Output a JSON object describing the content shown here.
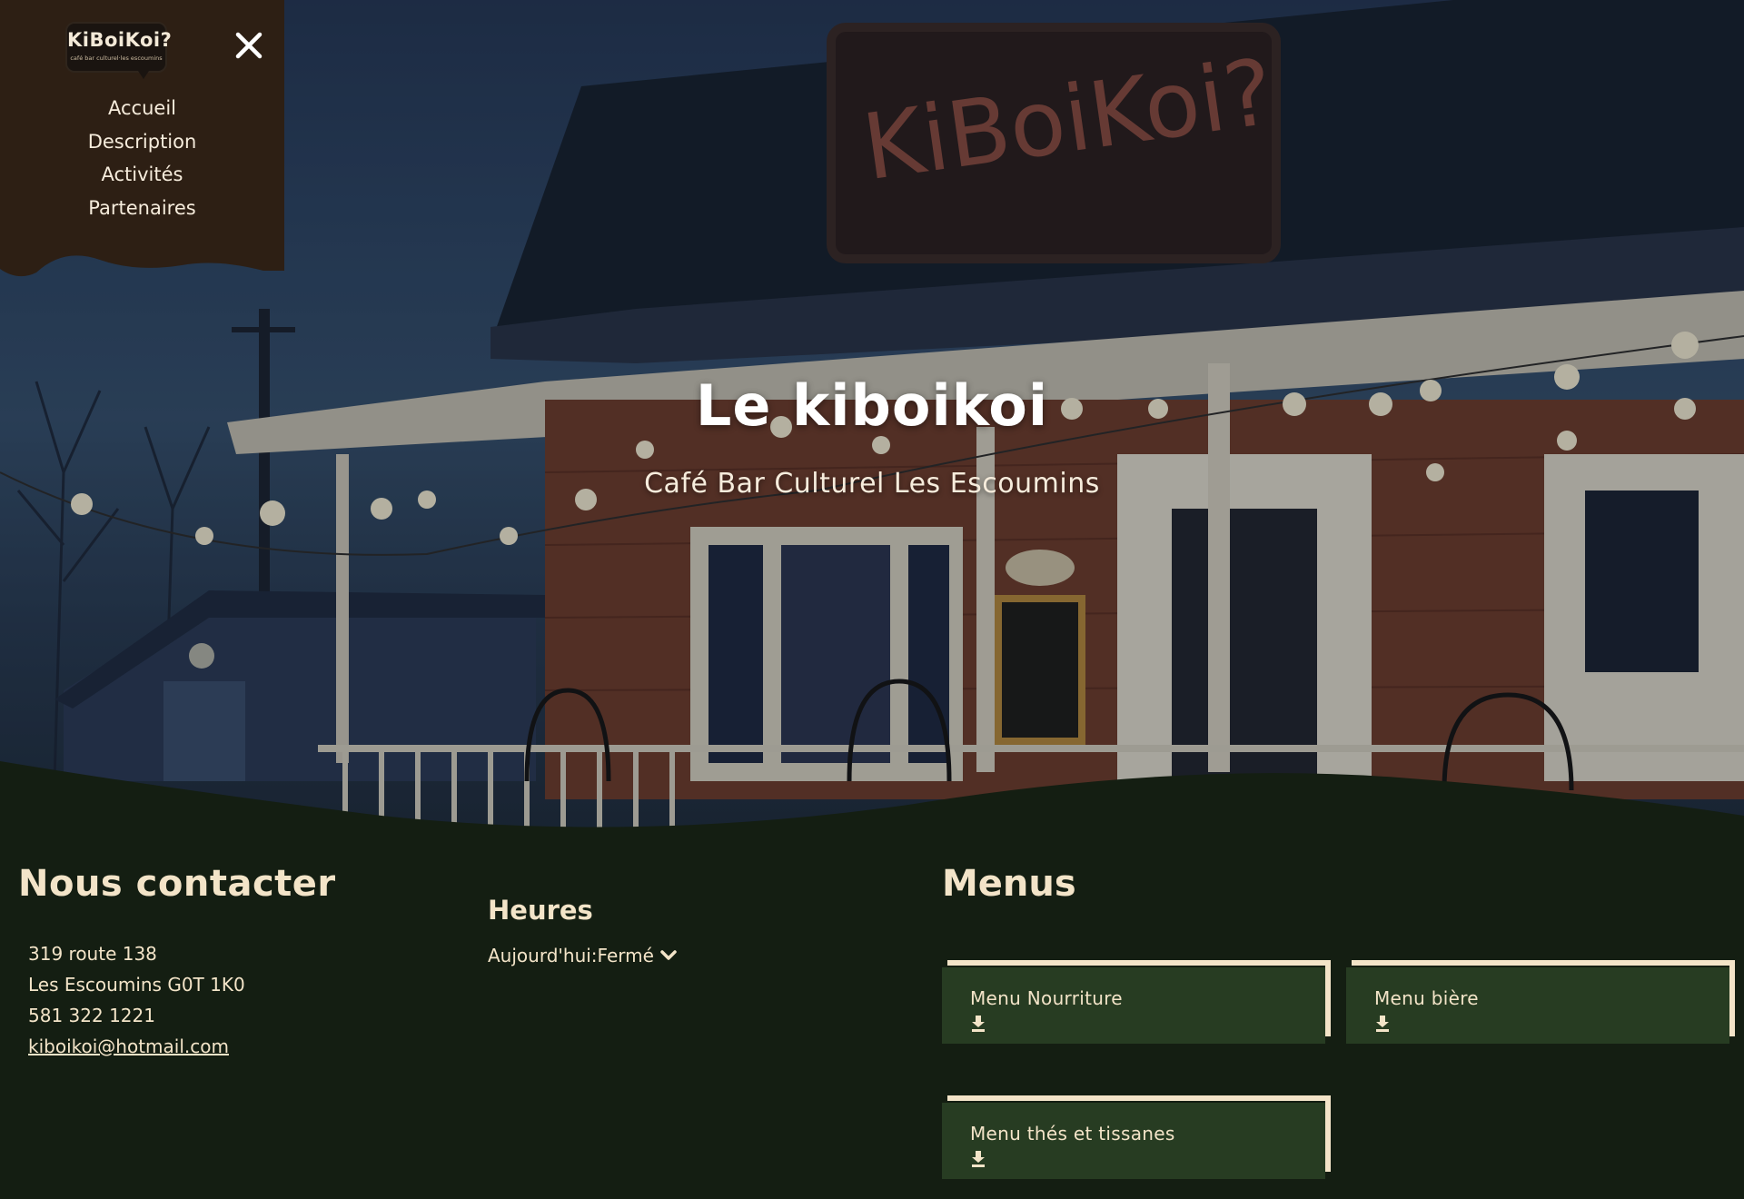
{
  "brand": {
    "logo_text": "KiBoiKoi?",
    "logo_subtext": "café bar culturel·les escoumins"
  },
  "nav": {
    "items": [
      {
        "label": "Accueil"
      },
      {
        "label": "Description"
      },
      {
        "label": "Activités"
      },
      {
        "label": "Partenaires"
      }
    ]
  },
  "hero": {
    "title": "Le kiboikoi",
    "subtitle": "Café Bar Culturel Les Escoumins"
  },
  "contact": {
    "heading": "Nous contacter",
    "address_line1": "319 route 138",
    "address_line2": "Les Escoumins G0T 1K0",
    "phone": "581 322 1221",
    "email": "kiboikoi@hotmail.com"
  },
  "hours": {
    "heading": "Heures",
    "today_label": "Aujourd'hui:",
    "today_status": "Fermé"
  },
  "menus": {
    "heading": "Menus",
    "items": [
      {
        "label": "Menu Nourriture"
      },
      {
        "label": "Menu bière"
      },
      {
        "label": "Menu thés et tissanes"
      }
    ]
  },
  "colors": {
    "menu_bg": "#2d1f14",
    "footer_bg": "#141e12",
    "card_bg": "#273c22",
    "accent_cream": "#f3e4c8"
  },
  "icons": [
    "close-icon",
    "chevron-down-icon",
    "download-icon"
  ]
}
